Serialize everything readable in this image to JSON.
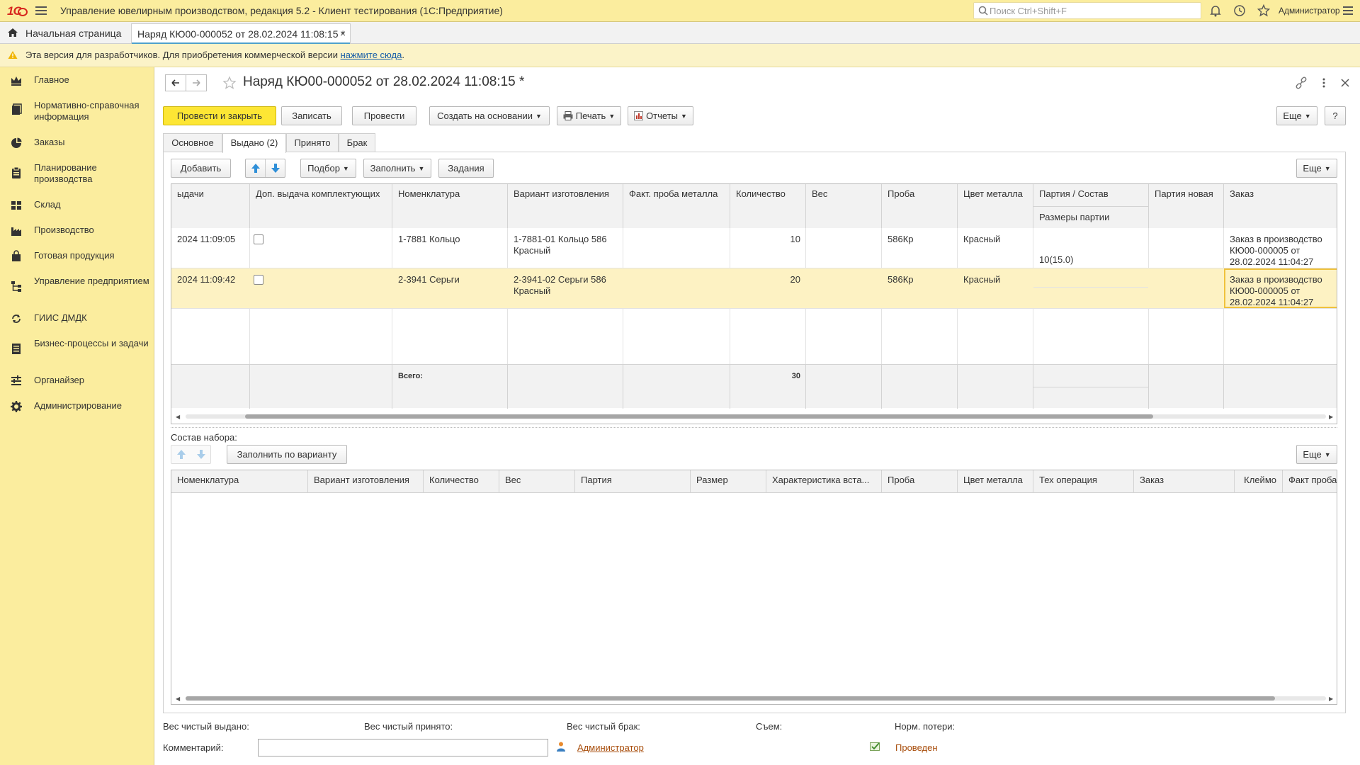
{
  "app": {
    "title": "Управление ювелирным производством, редакция 5.2  - Клиент тестирования (1С:Предприятие)",
    "logo_text": "1C",
    "search_placeholder": "Поиск Ctrl+Shift+F",
    "user": "Администратор"
  },
  "tabs": {
    "home": "Начальная страница",
    "document": "Наряд КЮ00-000052 от 28.02.2024 11:08:15 *"
  },
  "notice": {
    "text": "Эта версия для разработчиков. Для приобретения коммерческой версии ",
    "link": "нажмите сюда",
    "tail": "."
  },
  "sidebar": [
    {
      "label": "Главное",
      "icon": "crown-icon"
    },
    {
      "label": "Нормативно-справочная информация",
      "icon": "book-icon"
    },
    {
      "label": "Заказы",
      "icon": "pie-chart-icon"
    },
    {
      "label": "Планирование производства",
      "icon": "clipboard-icon"
    },
    {
      "label": "Склад",
      "icon": "warehouse-icon"
    },
    {
      "label": "Производство",
      "icon": "factory-icon"
    },
    {
      "label": "Готовая продукция",
      "icon": "bag-icon"
    },
    {
      "label": "Управление предприятием",
      "icon": "org-chart-icon"
    },
    {
      "label": "ГИИС ДМДК",
      "icon": "sync-icon"
    },
    {
      "label": "Бизнес-процессы и задачи",
      "icon": "tasks-icon"
    },
    {
      "label": "Органайзер",
      "icon": "organizer-icon"
    },
    {
      "label": "Администрирование",
      "icon": "gear-icon"
    }
  ],
  "document": {
    "title": "Наряд КЮ00-000052 от 28.02.2024 11:08:15 *"
  },
  "toolbar": {
    "post_close": "Провести и закрыть",
    "save": "Записать",
    "post": "Провести",
    "create_based": "Создать на основании",
    "print": "Печать",
    "reports": "Отчеты",
    "more": "Еще",
    "help": "?"
  },
  "form_tabs": [
    "Основное",
    "Выдано (2)",
    "Принято",
    "Брак"
  ],
  "grid_toolbar": {
    "add": "Добавить",
    "selection": "Подбор",
    "fill": "Заполнить",
    "tasks": "Задания",
    "more": "Еще"
  },
  "grid": {
    "columns": [
      "ыдачи",
      "Доп. выдача комплектующих",
      "Номенклатура",
      "Вариант изготовления",
      "Факт. проба металла",
      "Количество",
      "Вес",
      "Проба",
      "Цвет металла",
      "Партия / Состав",
      "Партия новая",
      "Заказ"
    ],
    "subheader": "Размеры партии",
    "rows": [
      {
        "date": "2024 11:09:05",
        "extra": false,
        "nomenclature": "1-7881 Кольцо",
        "variant": "1-7881-01 Кольцо 586 Красный",
        "fact_probe": "",
        "qty": "10",
        "weight": "",
        "probe": "586Кр",
        "color": "Красный",
        "batch": "",
        "batch_sizes": "10(15.0)",
        "batch_new": "",
        "order": "Заказ в производство КЮ00-000005 от 28.02.2024 11:04:27"
      },
      {
        "date": "2024 11:09:42",
        "extra": false,
        "nomenclature": "2-3941 Серьги",
        "variant": "2-3941-02 Серьги 586 Красный",
        "fact_probe": "",
        "qty": "20",
        "weight": "",
        "probe": "586Кр",
        "color": "Красный",
        "batch": "",
        "batch_sizes": "",
        "batch_new": "",
        "order": "Заказ в производство КЮ00-000005 от 28.02.2024 11:04:27"
      }
    ],
    "footer": {
      "label": "Всего:",
      "qty_total": "30"
    }
  },
  "set_section": {
    "label": "Состав набора:",
    "fill_by_variant": "Заполнить по варианту",
    "more": "Еще",
    "columns": [
      "Номенклатура",
      "Вариант изготовления",
      "Количество",
      "Вес",
      "Партия",
      "Размер",
      "Характеристика вста...",
      "Проба",
      "Цвет металла",
      "Тех операция",
      "Заказ",
      "Клеймо",
      "Факт проба"
    ]
  },
  "bottom": {
    "net_issued": "Вес чистый выдано:",
    "net_received": "Вес чистый принято:",
    "net_defect": "Вес чистый брак:",
    "removal": "Съем:",
    "norm_loss": "Норм. потери:",
    "comment_label": "Комментарий:",
    "comment_value": "",
    "author": "Администратор",
    "status": "Проведен"
  },
  "colors": {
    "topbar": "#fbed9e",
    "accent_yellow": "#fde634",
    "selected_row": "#fdf2c3",
    "link": "#a84d0b",
    "logo_red": "#d7261e"
  }
}
